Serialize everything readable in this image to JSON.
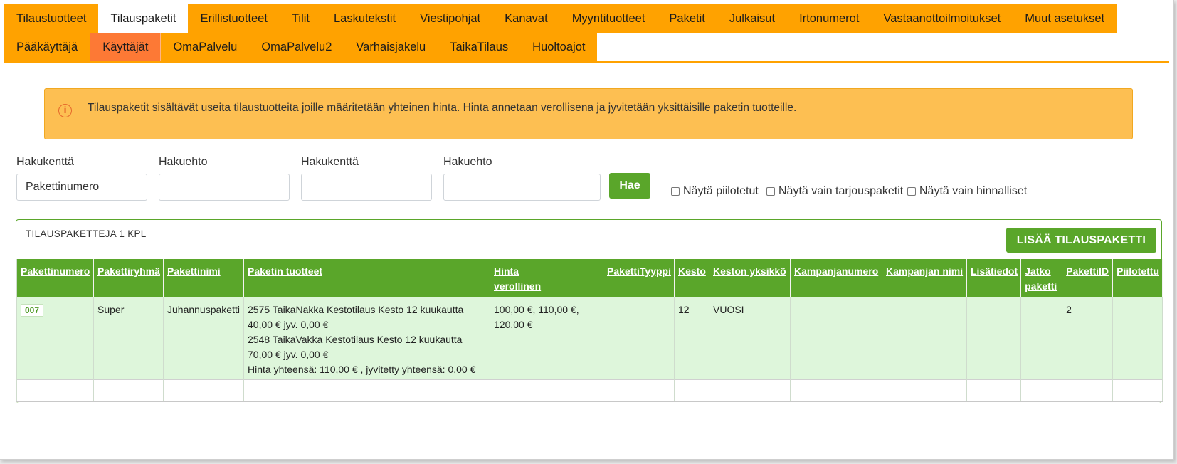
{
  "nav": {
    "row1": [
      "Tilaustuotteet",
      "Tilauspaketit",
      "Erillistuotteet",
      "Tilit",
      "Laskutekstit",
      "Viestipohjat",
      "Kanavat",
      "Myyntituotteet",
      "Paketit",
      "Julkaisut",
      "Irtonumerot",
      "Vastaanottoilmoitukset",
      "Muut asetukset"
    ],
    "row2": [
      "Pääkäyttäjä",
      "Käyttäjät",
      "OmaPalvelu",
      "OmaPalvelu2",
      "Varhaisjakelu",
      "TaikaTilaus",
      "Huoltoajot"
    ],
    "active_row1": "Tilauspaketit",
    "active_row2": "Käyttäjät"
  },
  "info": {
    "icon": "info-circle-icon",
    "text": "Tilauspaketit sisältävät useita tilaustuotteita joille määritetään yhteinen hinta. Hinta annetaan verollisena ja jyvitetään yksittäisille paketin tuotteille."
  },
  "search": {
    "field1_label": "Hakukenttä",
    "field1_value": "Pakettinumero",
    "cond1_label": "Hakuehto",
    "cond1_value": "",
    "field2_label": "Hakukenttä",
    "field2_value": "",
    "cond2_label": "Hakuehto",
    "cond2_value": "",
    "button_label": "Hae",
    "checkboxes": [
      "Näytä piilotetut",
      "Näytä vain tarjouspaketit",
      "Näytä vain hinnalliset"
    ]
  },
  "panel": {
    "title": "TILAUSPAKETTEJA 1 KPL",
    "add_button": "LISÄÄ TILAUSPAKETTI"
  },
  "table": {
    "headers": [
      "Pakettinumero",
      "Pakettiryhmä",
      "Pakettinimi",
      "Paketin tuotteet",
      [
        "Hinta",
        "verollinen"
      ],
      "PakettiTyyppi",
      "Kesto",
      "Keston yksikkö",
      "Kampanjanumero",
      "Kampanjan nimi",
      "Lisätiedot",
      [
        "Jatko",
        "paketti"
      ],
      "PakettiID",
      "Piilotettu"
    ],
    "rows": [
      {
        "pakettinumero": "007",
        "pakettiryhma": "Super",
        "pakettinimi": "Juhannuspaketti",
        "tuotteet": [
          "2575 TaikaNakka Kestotilaus Kesto 12 kuukautta",
          "40,00 € jyv. 0,00 €",
          "2548 TaikaVakka Kestotilaus Kesto 12 kuukautta",
          "70,00 € jyv. 0,00 €",
          "Hinta yhteensä: 110,00 € , jyvitetty yhteensä: 0,00 €"
        ],
        "hinta": [
          "100,00 €, 110,00 €,",
          "120,00 €"
        ],
        "tyyppi": "",
        "kesto": "12",
        "keston_yksikko": "VUOSI",
        "kampanjanumero": "",
        "kampanjan_nimi": "",
        "lisatiedot": "",
        "jatko": "",
        "pakettiid": "2",
        "piilotettu": ""
      }
    ]
  },
  "colors": {
    "nav_orange": "#ffa200",
    "active_orange": "#fd7935",
    "alert_bg": "#fdbf52",
    "green": "#5aa62a",
    "row_green": "#def6db"
  }
}
